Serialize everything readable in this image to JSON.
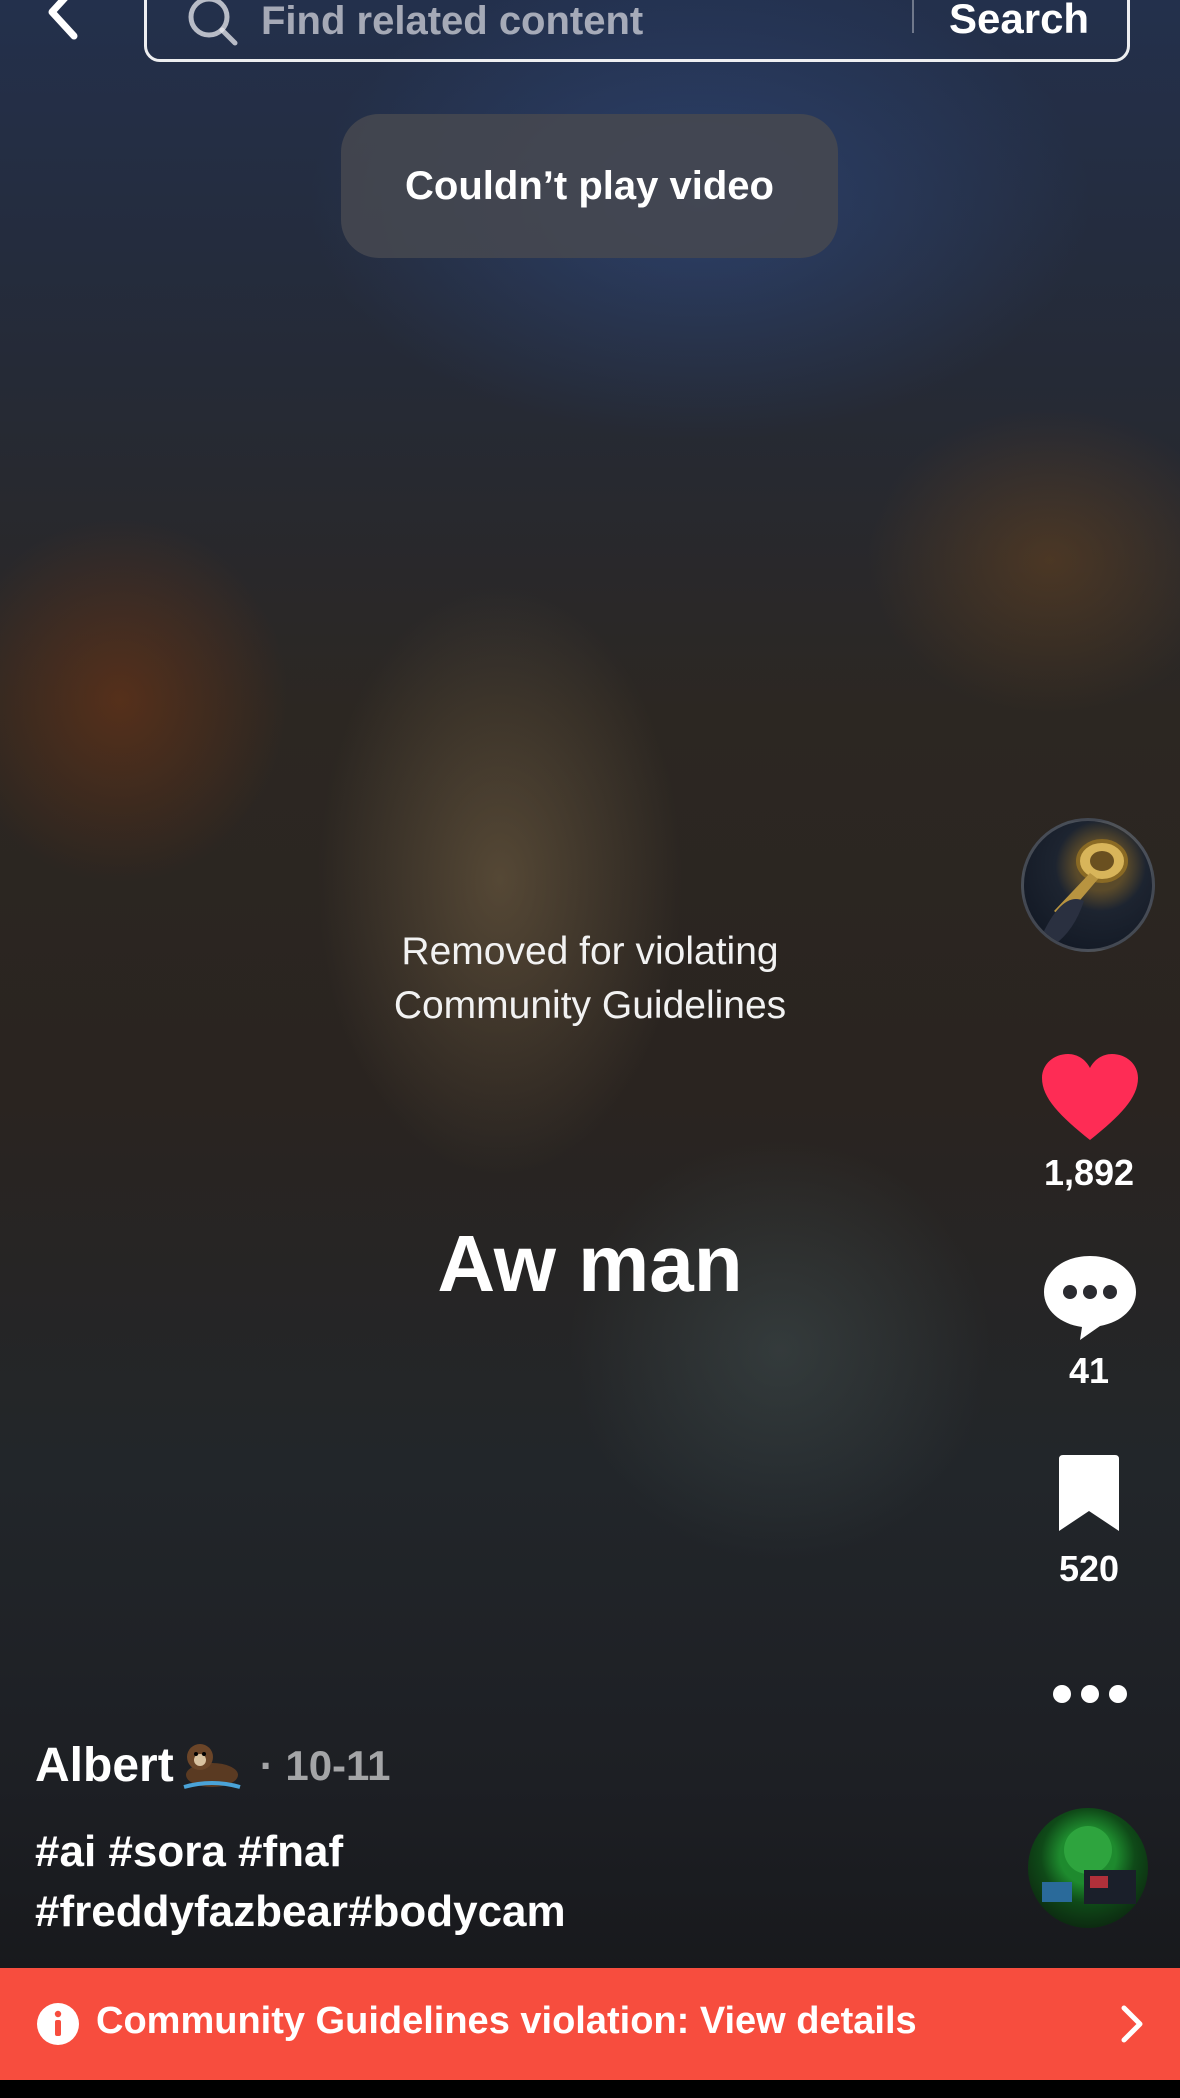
{
  "header": {
    "back_icon": "chevron-left-icon",
    "search_placeholder": "Find related content",
    "search_button": "Search"
  },
  "toast": {
    "message": "Couldn’t play video"
  },
  "video": {
    "removed_notice_line1": "Removed for violating",
    "removed_notice_line2": "Community Guidelines",
    "caption": "Aw man"
  },
  "actions": {
    "likes": "1,892",
    "comments": "41",
    "saves": "520",
    "like_color": "#fe2c55"
  },
  "post": {
    "author": "Albert",
    "author_emoji": "otter-icon",
    "date": "· 10-11",
    "hashtags_line1": "#ai #sora #fnaf",
    "hashtags_line2": "#freddyfazbear#bodycam"
  },
  "banner": {
    "text": "Community Guidelines violation: View details",
    "color": "#f74d3e"
  }
}
